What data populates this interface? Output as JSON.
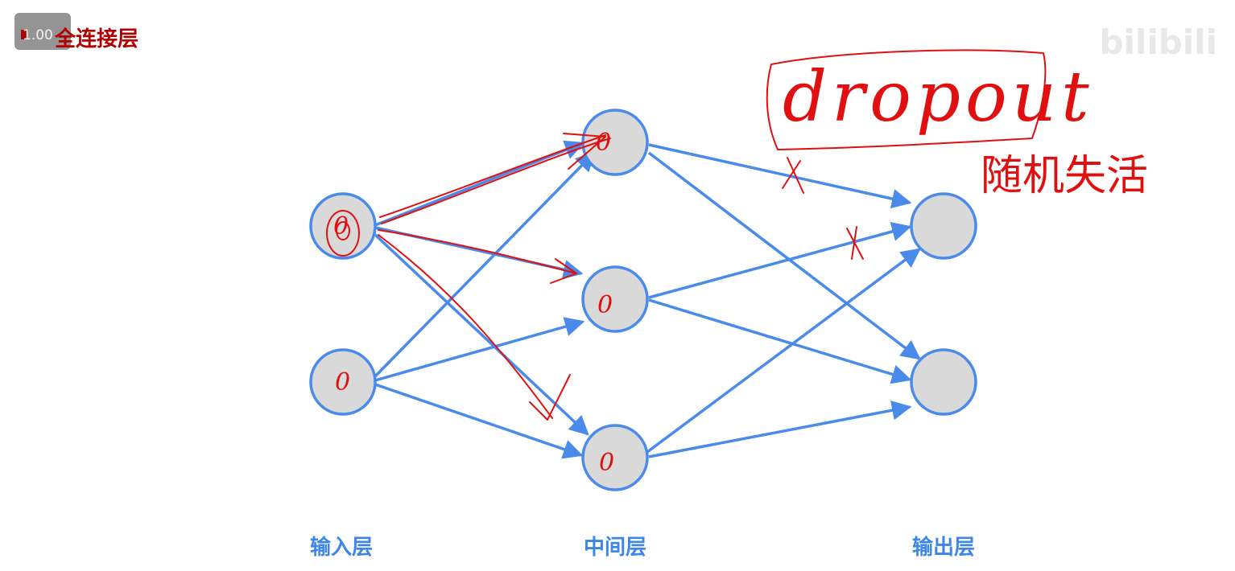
{
  "header": {
    "speed_label": "1.00",
    "title": "全连接层"
  },
  "watermark": {
    "prefix": "",
    "brand": "bilibili"
  },
  "layers": [
    {
      "label": "输入层",
      "nodes": 2
    },
    {
      "label": "中间层",
      "nodes": 3
    },
    {
      "label": "输出层",
      "nodes": 2
    }
  ],
  "annotations": {
    "dropout": "dropout",
    "random_deactivate": "随机失活",
    "node_marks": [
      "0",
      "0",
      "0",
      "0",
      "0"
    ],
    "dropped_mark": "X"
  },
  "colors": {
    "node_fill": "#d9d9d9",
    "node_stroke": "#4a8ae8",
    "edge": "#4a8ae8",
    "title": "#b00000",
    "ink": "#e01010"
  }
}
